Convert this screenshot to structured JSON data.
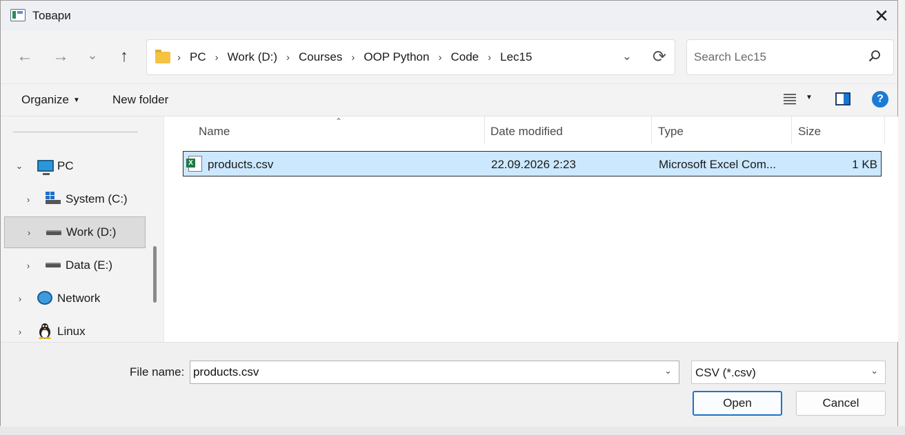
{
  "window": {
    "title": "Товари"
  },
  "nav": {
    "back": "←",
    "forward": "→",
    "recent": "⌄",
    "up": "↑"
  },
  "address": {
    "crumbs": [
      "PC",
      "Work (D:)",
      "Courses",
      "OOP Python",
      "Code",
      "Lec15"
    ],
    "separator": "›",
    "dropdown": "⌄",
    "refresh": "⟳"
  },
  "search": {
    "placeholder": "Search Lec15"
  },
  "toolbar": {
    "organize": "Organize",
    "new_folder": "New folder",
    "help": "?"
  },
  "navpane": {
    "items": [
      {
        "label": "PC",
        "icon": "monitor-icon",
        "expanded": true
      },
      {
        "label": "System (C:)",
        "icon": "windows-drive-icon",
        "expanded": false
      },
      {
        "label": "Work (D:)",
        "icon": "drive-icon",
        "expanded": false,
        "selected": true
      },
      {
        "label": "Data (E:)",
        "icon": "drive-icon",
        "expanded": false
      },
      {
        "label": "Network",
        "icon": "network-icon",
        "expanded": false
      },
      {
        "label": "Linux",
        "icon": "linux-icon",
        "expanded": false
      }
    ]
  },
  "filelist": {
    "columns": [
      "Name",
      "Date modified",
      "Type",
      "Size"
    ],
    "files": [
      {
        "name": "products.csv",
        "date": "22.09.2026 2:23",
        "type": "Microsoft Excel Com...",
        "size": "1 KB",
        "icon": "excel-csv-icon",
        "selected": true
      }
    ]
  },
  "bottom": {
    "file_name_label": "File name:",
    "file_name_value": "products.csv",
    "filter": "CSV (*.csv)",
    "open": "Open",
    "cancel": "Cancel"
  },
  "colors": {
    "selection": "#cce8ff",
    "accent": "#1a73c8",
    "folder": "#f5c242"
  }
}
